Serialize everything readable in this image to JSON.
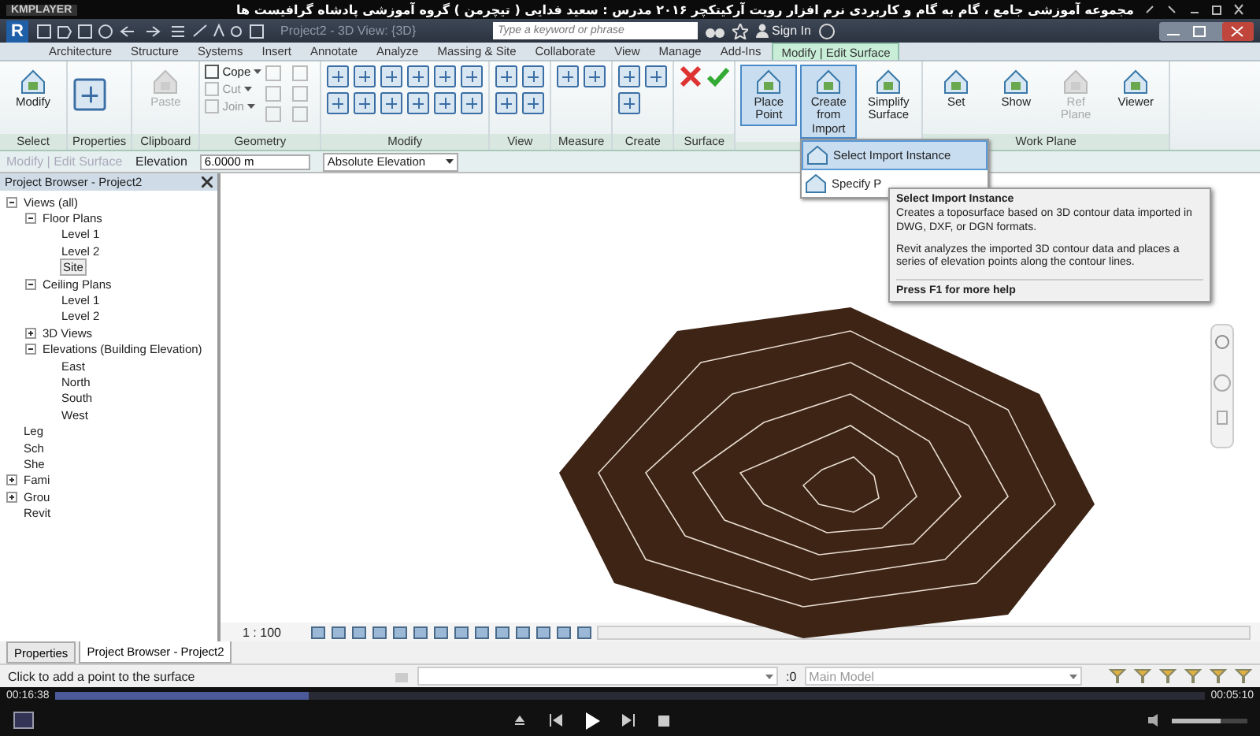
{
  "player": {
    "brand": "KMPLAYER",
    "title": "مجموعه آموزشی جامع ، گام به گام و کاربردی نرم افزار رویت آرکیتکچر ۲۰۱۶   مدرس : سعید فدایی ( تیچرمن ) گروه آموزشی پادشاه گرافیست ها",
    "elapsed": "00:16:38",
    "total": "00:05:10",
    "progress": {
      "level": 0.22
    },
    "volume": {
      "level": 0.65
    }
  },
  "app": {
    "logo": "R",
    "document_title": "Project2 - 3D View: {3D}",
    "search": {
      "placeholder": "Type a keyword or phrase"
    },
    "sign_in": "Sign In"
  },
  "tabs": [
    {
      "label": "Architecture",
      "selected": false
    },
    {
      "label": "Structure",
      "selected": false
    },
    {
      "label": "Systems",
      "selected": false
    },
    {
      "label": "Insert",
      "selected": false
    },
    {
      "label": "Annotate",
      "selected": false
    },
    {
      "label": "Analyze",
      "selected": false
    },
    {
      "label": "Massing & Site",
      "selected": false
    },
    {
      "label": "Collaborate",
      "selected": false
    },
    {
      "label": "View",
      "selected": false
    },
    {
      "label": "Manage",
      "selected": false
    },
    {
      "label": "Add-Ins",
      "selected": false
    },
    {
      "label": "Modify | Edit Surface",
      "selected": true
    }
  ],
  "ribbon": {
    "panels": [
      {
        "title": "Select",
        "buttons": [
          {
            "label": "Modify",
            "disabled": false,
            "selected": false
          }
        ]
      },
      {
        "title": "Properties"
      },
      {
        "title": "Clipboard",
        "buttons": [
          {
            "label": "Paste",
            "disabled": true,
            "selected": false
          }
        ]
      },
      {
        "title": "Geometry",
        "small_buttons": [
          {
            "label": "Cope",
            "disabled": false
          },
          {
            "label": "Cut",
            "disabled": true
          },
          {
            "label": "Join",
            "disabled": true
          }
        ]
      },
      {
        "title": "Modify"
      },
      {
        "title": "View"
      },
      {
        "title": "Measure"
      },
      {
        "title": "Create"
      },
      {
        "title": "Surface"
      },
      {
        "buttons": [
          {
            "label": "Place Point",
            "disabled": false,
            "selected": true
          },
          {
            "label": "Create from Import",
            "disabled": false,
            "selected": true
          },
          {
            "label": "Simplify Surface",
            "disabled": false,
            "selected": false
          }
        ]
      },
      {
        "title": "Work Plane",
        "buttons": [
          {
            "label": "Set",
            "disabled": false,
            "selected": false
          },
          {
            "label": "Show",
            "disabled": false,
            "selected": false
          },
          {
            "label": "Ref Plane",
            "disabled": true,
            "selected": false
          },
          {
            "label": "Viewer",
            "disabled": false,
            "selected": false
          }
        ]
      }
    ]
  },
  "options_bar": {
    "context": "Modify | Edit Surface",
    "elevation_label": "Elevation",
    "elevation": "6.0000 m",
    "elevation_mode": "Absolute Elevation"
  },
  "import_menu": {
    "items": [
      {
        "label": "Select Import Instance",
        "selected": true
      },
      {
        "label": "Specify P",
        "selected": false
      }
    ]
  },
  "tooltip": {
    "title": "Select Import Instance",
    "paragraphs": [
      "Creates a toposurface based on 3D contour data imported in DWG, DXF, or DGN formats.",
      "Revit analyzes the imported 3D contour data and places a series of elevation points along the contour lines."
    ],
    "help": "Press F1 for more help"
  },
  "project_browser": {
    "title": "Project Browser - Project2",
    "tree": [
      {
        "label": "Views (all)",
        "expanded": true,
        "selected": false,
        "children": [
          {
            "label": "Floor Plans",
            "expanded": true,
            "selected": false,
            "children": [
              {
                "label": "Level 1",
                "selected": false
              },
              {
                "label": "Level 2",
                "selected": false
              },
              {
                "label": "Site",
                "selected": true
              }
            ]
          },
          {
            "label": "Ceiling Plans",
            "expanded": true,
            "selected": false,
            "children": [
              {
                "label": "Level 1",
                "selected": false
              },
              {
                "label": "Level 2",
                "selected": false
              }
            ]
          },
          {
            "label": "3D Views",
            "expanded": false,
            "selected": false
          },
          {
            "label": "Elevations (Building Elevation)",
            "expanded": true,
            "selected": false,
            "children": [
              {
                "label": "East",
                "selected": false
              },
              {
                "label": "North",
                "selected": false
              },
              {
                "label": "South",
                "selected": false
              },
              {
                "label": "West",
                "selected": false
              }
            ]
          }
        ]
      },
      {
        "label": "Leg",
        "selected": false
      },
      {
        "label": "Sch",
        "selected": false
      },
      {
        "label": "She",
        "selected": false
      },
      {
        "label": "Fami",
        "expanded": false,
        "selected": false
      },
      {
        "label": "Grou",
        "expanded": false,
        "selected": false
      },
      {
        "label": "Revit",
        "selected": false
      }
    ]
  },
  "bottom_tabs": [
    {
      "label": "Properties",
      "selected": false
    },
    {
      "label": "Project Browser - Project2",
      "selected": true
    }
  ],
  "view_bar": {
    "scale": "1 : 100"
  },
  "status_bar": {
    "message": "Click to add a point to the surface",
    "count": ":0",
    "model": "Main Model"
  }
}
